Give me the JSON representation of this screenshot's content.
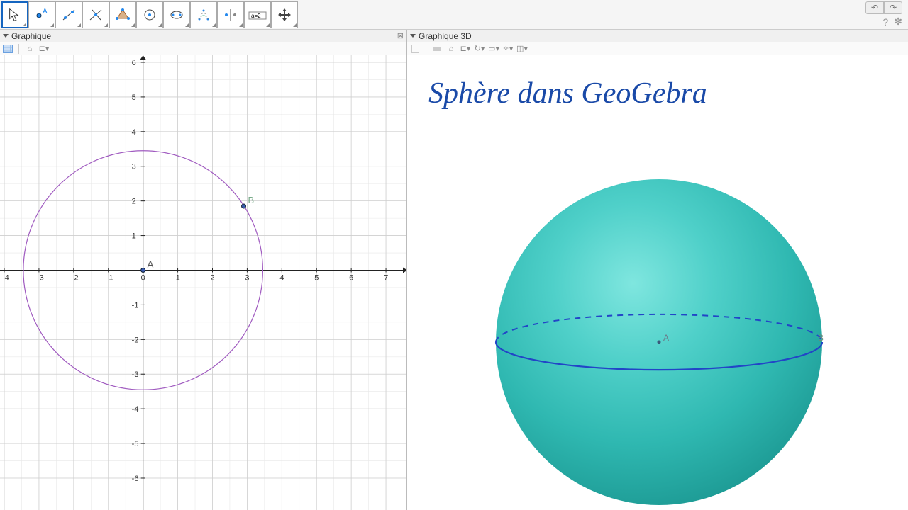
{
  "toolbar": {
    "tools": [
      "move",
      "point",
      "line",
      "perpendicular",
      "polygon",
      "circle",
      "conic",
      "angle",
      "transform",
      "slider",
      "move-view"
    ]
  },
  "panels": {
    "left_title": "Graphique",
    "right_title": "Graphique 3D"
  },
  "grid2d": {
    "x_min": -4,
    "x_max": 7,
    "y_min": -6,
    "y_max": 6,
    "x_ticks": [
      -4,
      -3,
      -2,
      -1,
      0,
      1,
      2,
      3,
      4,
      5,
      6,
      7
    ],
    "y_ticks": [
      -6,
      -5,
      -4,
      -3,
      -2,
      -1,
      1,
      2,
      3,
      4,
      5,
      6
    ],
    "circle": {
      "cx": 0,
      "cy": 0,
      "r": 3.45,
      "color": "#a05bc0"
    },
    "points": {
      "A": {
        "x": 0,
        "y": 0,
        "label": "A"
      },
      "B": {
        "x": 2.9,
        "y": 1.85,
        "label": "B"
      }
    }
  },
  "view3d": {
    "title": "Sphère dans GeoGebra",
    "sphere_color": "#3cc4c0",
    "equator_color": "#2245c7",
    "center_label": "A",
    "rim_label": "B"
  }
}
